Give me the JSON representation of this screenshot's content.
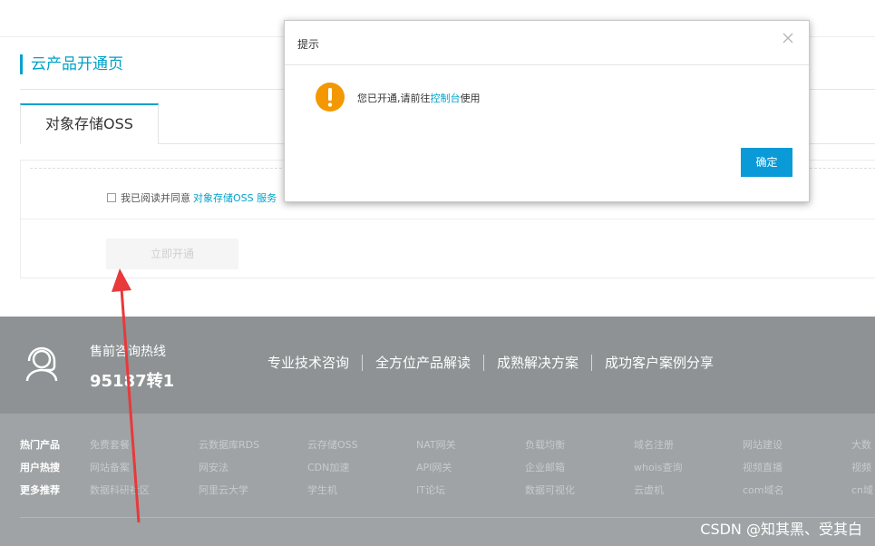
{
  "page": {
    "title": "云产品开通页",
    "tab_label": "对象存储OSS",
    "agreement_text": "我已阅读并同意",
    "agreement_link": "对象存储OSS 服务",
    "open_button": "立即开通"
  },
  "dialog": {
    "title": "提示",
    "message_before": "您已开通,请前往",
    "message_link": "控制台",
    "message_after": "使用",
    "ok_button": "确定",
    "icon": "warning-icon",
    "close_icon": "close-icon"
  },
  "footer": {
    "hotline_label": "售前咨询热线",
    "hotline_number": "95187转1",
    "services": [
      "专业技术咨询",
      "全方位产品解读",
      "成熟解决方案",
      "成功客户案例分享"
    ],
    "rows": [
      {
        "label": "热门产品",
        "items": [
          "免费套餐",
          "云数据库RDS",
          "云存储OSS",
          "NAT网关",
          "负载均衡",
          "域名注册",
          "网站建设",
          "大数"
        ]
      },
      {
        "label": "用户热搜",
        "items": [
          "网站备案",
          "网安法",
          "CDN加速",
          "API网关",
          "企业邮箱",
          "whois查询",
          "视频直播",
          "视频"
        ]
      },
      {
        "label": "更多推荐",
        "items": [
          "数据科研社区",
          "阿里云大学",
          "学生机",
          "IT论坛",
          "数据可视化",
          "云虚机",
          "com域名",
          "cn域"
        ]
      }
    ]
  },
  "watermark": "CSDN @知其黑、受其白",
  "colors": {
    "accent": "#00a2ca",
    "button": "#0a9ad7",
    "warning": "#f39800",
    "footer_bg": "#9fa3a5",
    "annotation_arrow": "#e8393b"
  }
}
